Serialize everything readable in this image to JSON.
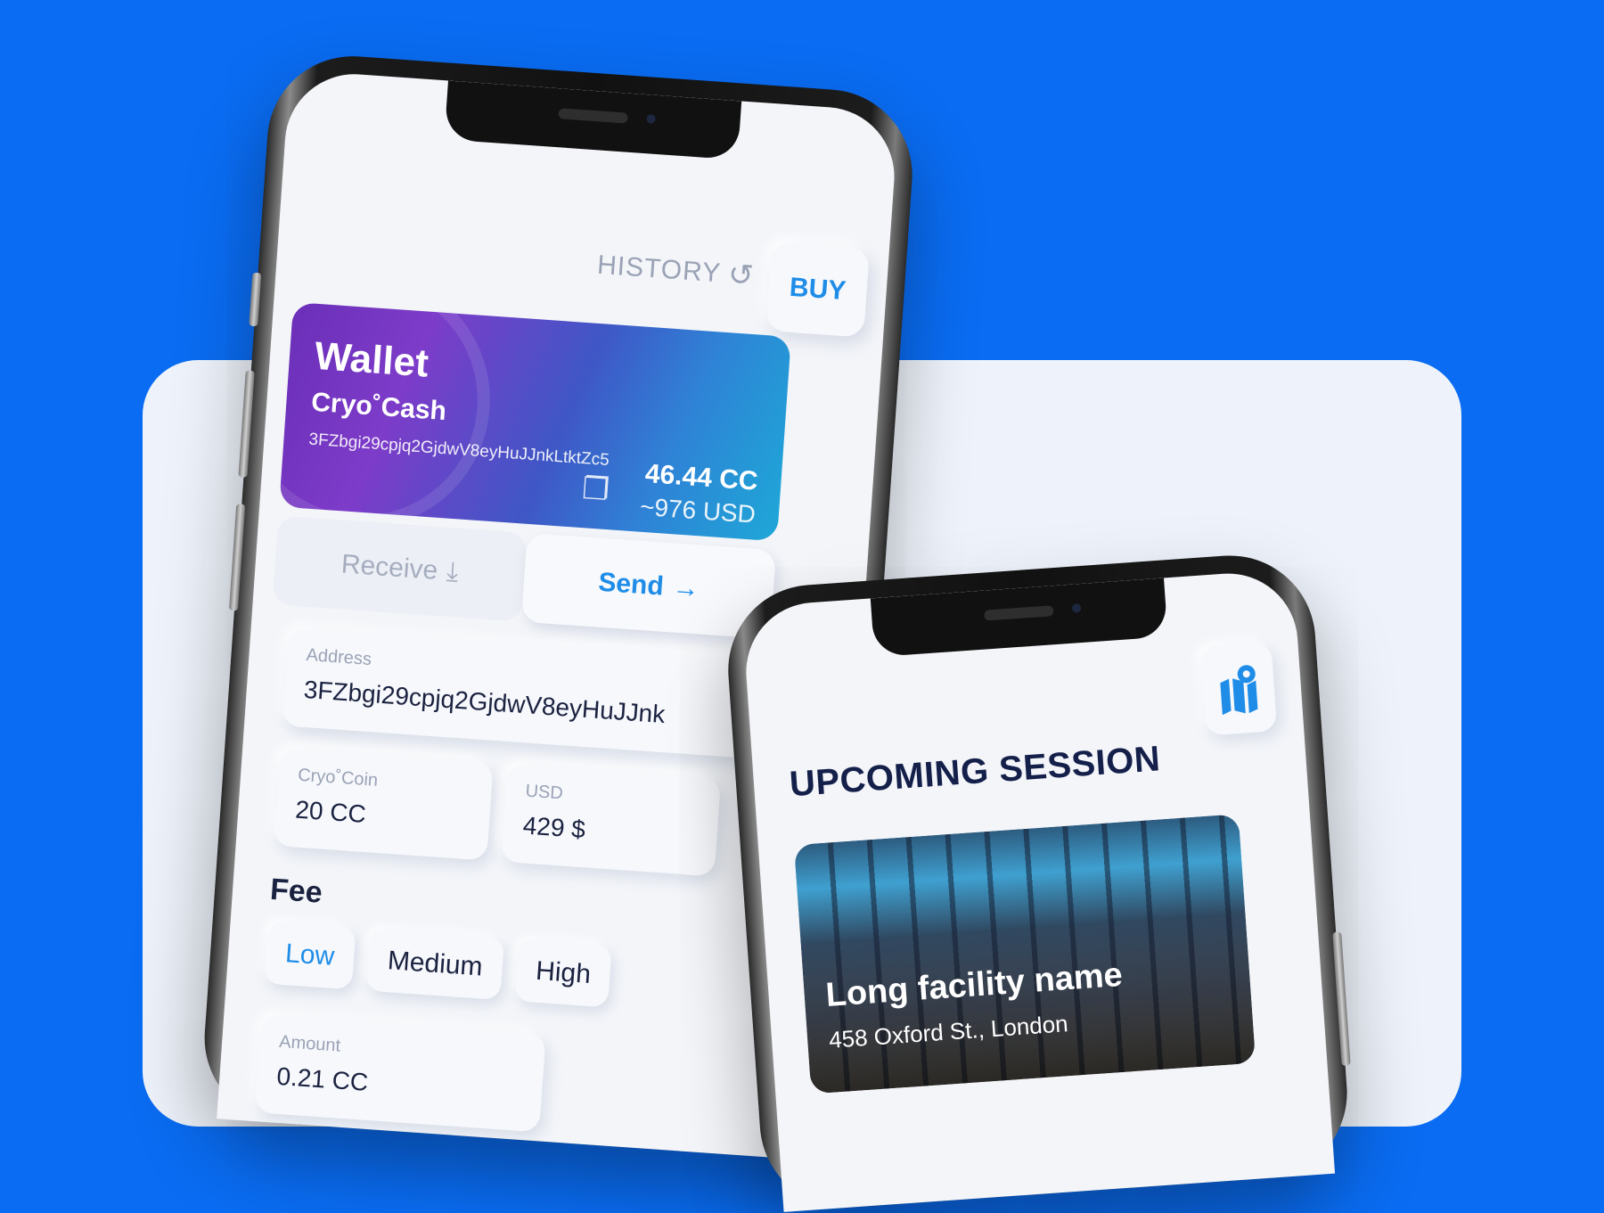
{
  "wallet_app": {
    "history_label": "HISTORY",
    "buy_label": "BUY",
    "card": {
      "title": "Wallet",
      "coin_name": "Cryo˚Cash",
      "address": "3FZbgi29cpjq2GjdwV8eyHuJJnkLtktZc5",
      "balance": "46.44 CC",
      "balance_usd": "~976 USD"
    },
    "tabs": {
      "receive": "Receive",
      "send": "Send"
    },
    "address_field": {
      "label": "Address",
      "value": "3FZbgi29cpjq2GjdwV8eyHuJJnk"
    },
    "coin_field": {
      "label": "Cryo˚Coin",
      "value": "20 CC"
    },
    "usd_field": {
      "label": "USD",
      "value": "429 $"
    },
    "fee": {
      "title": "Fee",
      "options": [
        "Low",
        "Medium",
        "High"
      ],
      "selected": "Low"
    },
    "amount_field": {
      "label": "Amount",
      "value": "0.21 CC"
    }
  },
  "session_app": {
    "title": "UPCOMING SESSION",
    "facility_name": "Long facility name",
    "facility_address": "458 Oxford St., London"
  },
  "colors": {
    "background": "#0a6cf2",
    "accent": "#1f8de8",
    "text_dark": "#14204a"
  }
}
